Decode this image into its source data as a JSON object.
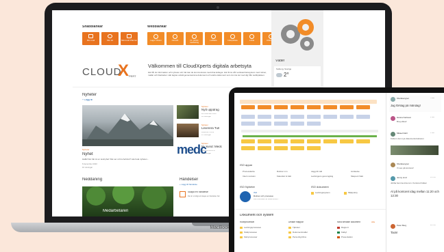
{
  "laptop": {
    "brand": "MacBook",
    "quick_links": {
      "title": "Snabblänkar",
      "items": [
        {
          "label": "Min mail",
          "icon": "mail-icon"
        },
        {
          "label": "Min tid",
          "icon": "clock-icon"
        },
        {
          "label": "Microsoft Planner",
          "icon": "planner-icon"
        }
      ]
    },
    "web_links": {
      "title": "Webblänkar",
      "items": [
        {
          "label": "Lager Vision",
          "icon": "link-icon"
        },
        {
          "label": "CloudX",
          "icon": "link-icon"
        },
        {
          "label": "CL public marketing",
          "icon": "link-icon"
        },
        {
          "label": "Leftlabs",
          "icon": "link-icon"
        },
        {
          "label": "Inköpslista",
          "icon": "link-icon"
        },
        {
          "label": "Lokal",
          "icon": "link-icon"
        },
        {
          "label": "Utbildning",
          "icon": "link-icon"
        }
      ]
    },
    "logo": {
      "text_left": "CLOUD",
      "text_x": "X",
      "text_sub": "PERT"
    },
    "welcome": {
      "title": "Välkommen till CloudXperts digitala arbetsyta",
      "body": "Här får du information och nyheter och här kan du kommunicera med dina kollegor. Här finns vårt verksamhetssystem med rutiner, mallar och blanketter. Här lagras också gemensamma dokument och andra dokument som du inte tar med dig från webbplatsen."
    },
    "news": {
      "title": "Nyheter",
      "add": "+ Lägg till",
      "main": {
        "tag": "Nyheter",
        "title": "Nyhet",
        "body": "Hallå! Det här är en testnyhet! Det ser ut bra behövs? Läs hela nyheten...",
        "meta": "8 december 2020",
        "views": "10 visningar"
      },
      "side": [
        {
          "tag": "Nyheter",
          "title": "Nytt uppdrag",
          "meta": "28 november 2020",
          "views": "34 visningar"
        },
        {
          "tag": "Nyheter",
          "title": "Leverera Tull",
          "meta": "Leverera Tull till",
          "views": "15 visningar"
        },
        {
          "tag": "Nyheter",
          "title": "Ny kund: Medc",
          "meta": "Medicon AB är en",
          "views": "22 visningar"
        }
      ]
    },
    "neddaning": {
      "title": "Neddaning",
      "image_caption": "Medarbetaren"
    },
    "events": {
      "title": "Händelser",
      "add": "+ Lägg till händelse",
      "item_title": "Skapa en händelse",
      "item_body": "Det är smidigt att skapa en händelse här"
    },
    "sidebar": {
      "weather_title": "Väder",
      "city1": "Sotberg, Sverige",
      "temp": "2°",
      "city2": "Göteborg, Sverige"
    }
  },
  "tablet": {
    "iso_apps": {
      "title": "ISO appar",
      "items": [
        "Processkarta",
        "Rutiner mm",
        "Lägg till mål",
        "Avvikelse",
        "Intern revision",
        "Kalendar & Vakt",
        "Ledningens genomgång",
        "Skapa & Vakt"
      ]
    },
    "iso_news": {
      "title": "ISO Nyheter",
      "item_tag": "ISO",
      "item_title": "Rutiner och processer",
      "item_body": "Den ena delen av dokumenten..."
    },
    "iso_docs": {
      "title": "ISO dokument",
      "items": [
        "Ledningssystem",
        "Miljöpolicy"
      ]
    },
    "docs": {
      "title": "Dokument och system",
      "cols": [
        {
          "title": "Rutinprocesser",
          "items": [
            "Ledningsprocesser",
            "Stödprocesser",
            "Kärnprocesser"
          ]
        },
        {
          "title": "Delade mappar",
          "items": [
            "Tjänster",
            "Dokumentmallar",
            "Personlig Drive"
          ]
        },
        {
          "title": "Mina senaste dokument",
          "items": [
            "Rapport",
            "Kalkyl",
            "Presentation"
          ]
        }
      ],
      "all_label": "Alla"
    },
    "feed": [
      {
        "name": "Ola Ekengren",
        "time": "5 dec",
        "text": "Jag förslag på måndag!"
      },
      {
        "name": "Hanna Karlsson",
        "time": "2 dec",
        "text": "Bra jobbat!"
      },
      {
        "name": "Mikael Dahl",
        "time": "1 dec",
        "text": "Kolla in den nya dokumentstrukturen"
      },
      {
        "name": "Ola Ekengren",
        "time": "28 nov",
        "text": "Vi ses på kontoret!"
      },
      {
        "name": "Jenny Lind",
        "time": "25 nov",
        "text": "Jobba hemma inta rem. Kontoret hälsar"
      },
      {
        "name": "Peter Berg",
        "time": "20 nov",
        "text": "Tack!"
      }
    ],
    "feed_extra": "Al på kontoret idag mellan 11:20 och 12:30"
  },
  "colors": {
    "accent": "#e8731f",
    "accent2": "#f28c28",
    "bg": "#fbe7da",
    "frame": "#1c1c1e",
    "yellow": "#f7c843",
    "green": "#6bb24a"
  }
}
